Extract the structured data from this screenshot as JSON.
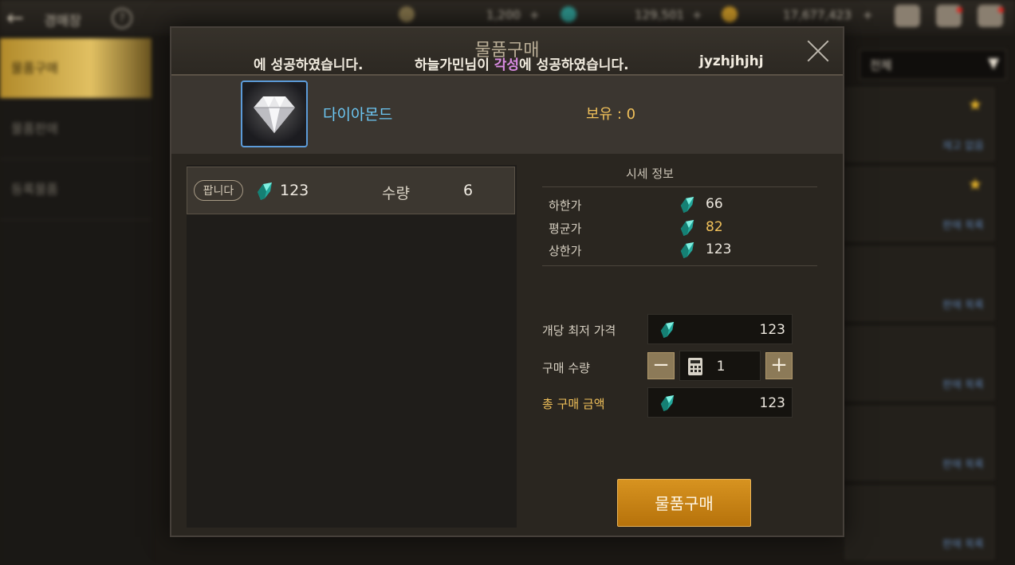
{
  "topbar": {
    "title": "경매장",
    "currency_1": "1,200",
    "currency_2": "129,501",
    "currency_3": "17,677,423"
  },
  "sidebar": {
    "items": [
      {
        "label": "물품구매"
      },
      {
        "label": "물품판매"
      },
      {
        "label": "등록물품"
      }
    ]
  },
  "right_panel": {
    "filter": "전체",
    "card_labels": [
      "재고 없음",
      "판매 목록",
      "판매 목록",
      "판매 목록",
      "판매 목록",
      "판매 목록"
    ]
  },
  "dialog": {
    "title": "물품구매",
    "ticker": {
      "msg1": "에 성공하였습니다.",
      "msg2_prefix": "하늘가민님이 ",
      "msg2_highlight": "각성",
      "msg2_suffix": "에 성공하였습니다.",
      "msg3": "jyzhjhjhj"
    },
    "item": {
      "name": "다이아몬드",
      "owned": "보유 : 0"
    },
    "listing": {
      "badge": "팝니다",
      "price": "123",
      "qty_label": "수량",
      "qty": "6"
    },
    "market": {
      "title": "시세 정보",
      "rows": [
        {
          "label": "하한가",
          "value": "66"
        },
        {
          "label": "평균가",
          "value": "82"
        },
        {
          "label": "상한가",
          "value": "123"
        }
      ]
    },
    "form": {
      "unit_price_label": "개당 최저 가격",
      "unit_price": "123",
      "quantity_label": "구매 수량",
      "quantity": "1",
      "total_label": "총 구매 금액",
      "total": "123"
    },
    "buy_button": "물품구매"
  },
  "colors": {
    "accent_gold": "#f1c15a",
    "item_name_blue": "#6cc6f2",
    "buy_button": "#c78216"
  },
  "icons": [
    "back-arrow-icon",
    "help-icon",
    "close-icon",
    "gem-icon",
    "calculator-icon",
    "minus-icon",
    "plus-icon",
    "diamond-item-icon"
  ]
}
